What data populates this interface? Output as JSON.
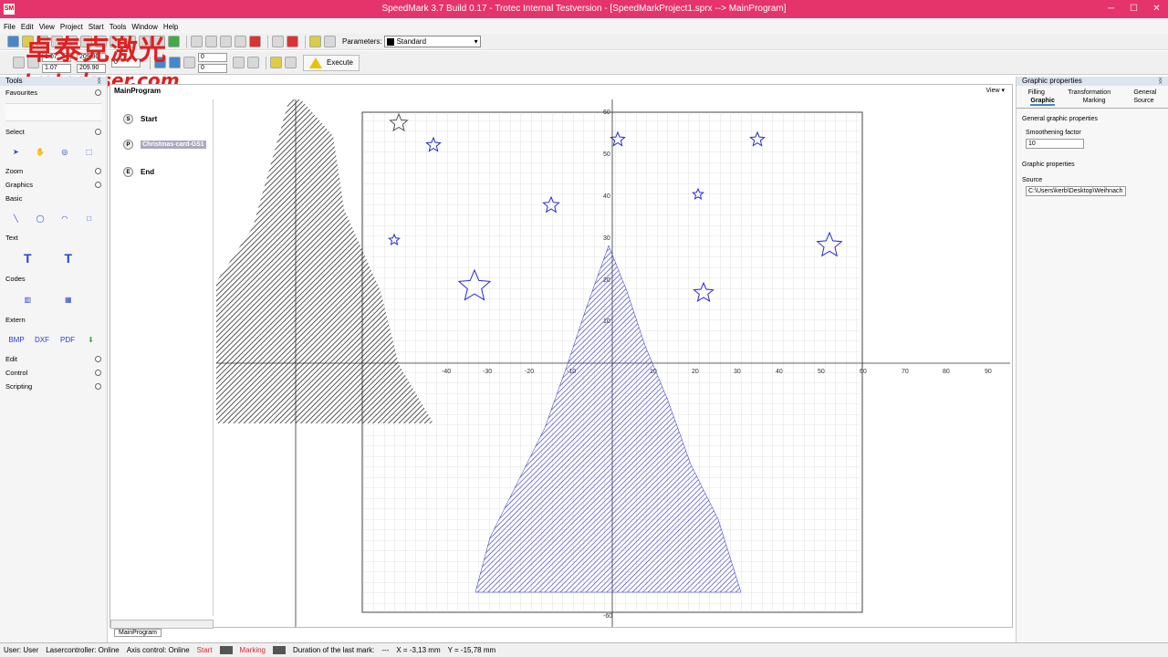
{
  "window": {
    "title": "SpeedMark 3.7 Build 0.17 - Trotec Internal Testversion - [SpeedMarkProject1.sprx --> MainProgram]",
    "app_icon": "SM"
  },
  "menu": [
    "File",
    "Edit",
    "View",
    "Project",
    "Start",
    "Tools",
    "Window",
    "Help"
  ],
  "toolbar": {
    "parameters_label": "Parameters:",
    "parameters_value": "Standard",
    "execute_label": "Execute",
    "coord_x": "1.07",
    "coord_y": "1.07",
    "width": "209.90",
    "height": "209.90",
    "rotation": "0",
    "offset_x": "0",
    "offset_y": "0"
  },
  "watermark": {
    "line1": "卓泰克激光",
    "line2": "trotedaser.com"
  },
  "tools": {
    "title": "Tools",
    "favourites": "Favourites",
    "select": "Select",
    "zoom": "Zoom",
    "graphics": "Graphics",
    "basic": "Basic",
    "text": "Text",
    "codes": "Codes",
    "extern": "Extern",
    "edit": "Edit",
    "control": "Control",
    "scripting": "Scripting",
    "extern_items": [
      "BMP",
      "DXF",
      "PDF"
    ]
  },
  "program": {
    "title": "MainProgram",
    "view_label": "View",
    "nodes": {
      "start": "Start",
      "pdf": "Christmas-card-GS1",
      "end": "End"
    },
    "tab": "MainProgram",
    "axis_x_labels": [
      "-40",
      "-30",
      "-20",
      "-10",
      "10",
      "20",
      "30",
      "40",
      "50",
      "60",
      "70",
      "80",
      "90"
    ],
    "axis_y_labels": [
      "60",
      "50",
      "40",
      "30",
      "20",
      "10"
    ],
    "bottom_y_label": "-60"
  },
  "properties": {
    "title": "Graphic properties",
    "tabs_row1": [
      "Filling",
      "Transformation",
      "General"
    ],
    "tabs_row2": [
      "Graphic",
      "Marking",
      "Source"
    ],
    "active_tab": "Graphic",
    "general_label": "General graphic properties",
    "smoothing_label": "Smoothening factor",
    "smoothing_value": "10",
    "graphic_props_label": "Graphic properties",
    "source_label": "Source",
    "source_value": "C:\\Users\\kerb\\Desktop\\Weihnach"
  },
  "status": {
    "user": "User: User",
    "laser": "Lasercontroller: Online",
    "axis": "Axis control: Online",
    "start": "Start",
    "marking": "Marking",
    "duration": "Duration of the last mark:",
    "duration_value": "---",
    "x": "X = -3,13 mm",
    "y": "Y = -15,78 mm"
  },
  "colors": {
    "title_bar": "#e5336b",
    "design": "#2a2ad0",
    "accent_status": "#d23"
  }
}
